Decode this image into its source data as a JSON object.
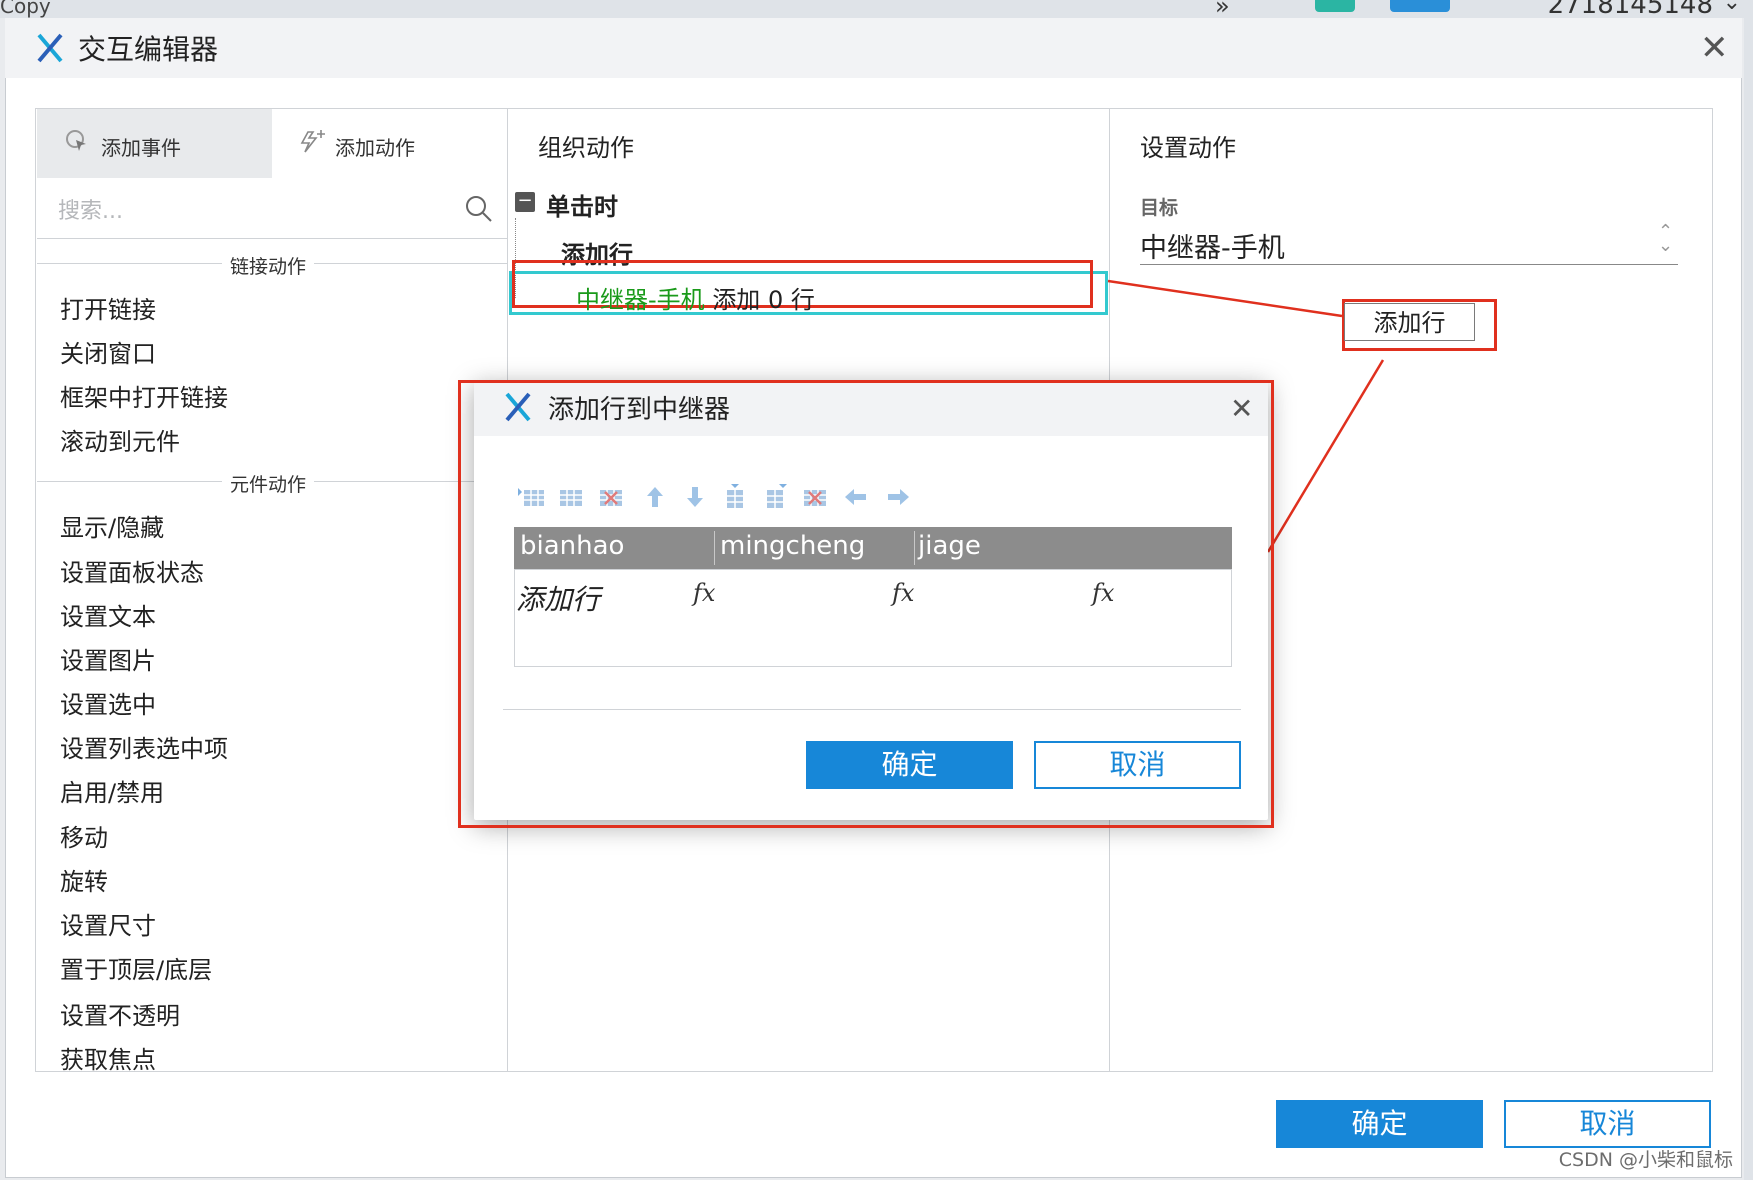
{
  "background_app": {
    "copy_label": "Copy",
    "id_number": "2718145148",
    "expand_chevron": "⌄"
  },
  "dialog": {
    "title": "交互编辑器",
    "close_icon": "close-icon",
    "confirm_label": "确定",
    "cancel_label": "取消"
  },
  "left_panel": {
    "tabs": [
      {
        "label": "添加事件",
        "icon": "event-cursor-icon",
        "active": true
      },
      {
        "label": "添加动作",
        "icon": "action-spark-icon",
        "active": false
      }
    ],
    "search_placeholder": "搜索...",
    "groups": [
      {
        "label": "链接动作",
        "items": [
          "打开链接",
          "关闭窗口",
          "框架中打开链接",
          "滚动到元件"
        ]
      },
      {
        "label": "元件动作",
        "items": [
          "显示/隐藏",
          "设置面板状态",
          "设置文本",
          "设置图片",
          "设置选中",
          "设置列表选中项",
          "启用/禁用",
          "移动",
          "旋转",
          "设置尺寸",
          "置于顶层/底层",
          "设置不透明",
          "获取焦点"
        ]
      }
    ]
  },
  "middle_panel": {
    "title": "组织动作",
    "event_label": "单击时",
    "action_label": "添加行",
    "item_target": "中继器-手机",
    "item_suffix": "添加 0 行"
  },
  "right_panel": {
    "title": "设置动作",
    "target_label": "目标",
    "target_value": "中继器-手机",
    "annotation_button": "添加行"
  },
  "sub_dialog": {
    "title": "添加行到中继器",
    "toolbar_icons": [
      "insert-row-icon",
      "append-row-icon",
      "delete-row-icon",
      "move-up-icon",
      "move-down-icon",
      "insert-column-icon",
      "append-column-icon",
      "delete-column-icon",
      "move-left-icon",
      "move-right-icon"
    ],
    "columns": [
      "bianhao",
      "mingcheng",
      "jiage"
    ],
    "row_label": "添加行",
    "fx_symbol": "fx",
    "confirm_label": "确定",
    "cancel_label": "取消"
  },
  "watermark": "CSDN @小柴和鼠标",
  "colors": {
    "primary_button": "#1787d8",
    "highlight_cyan": "#33c9cf",
    "annotation_red": "#e0301e",
    "green_text": "#1a9a1a",
    "grid_header": "#8c8c8c"
  }
}
